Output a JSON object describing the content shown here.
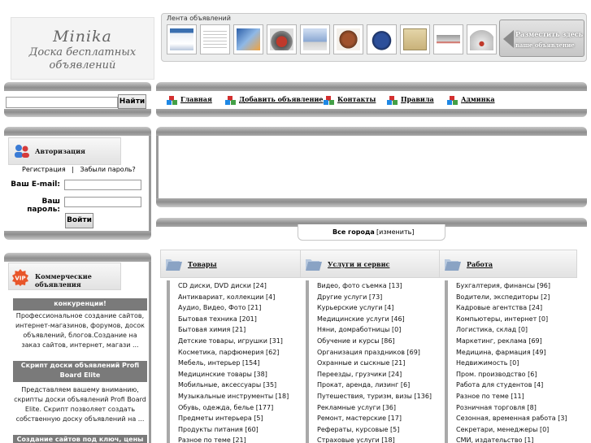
{
  "logo": {
    "line1": "Minika",
    "line2": "Доска бесплатных",
    "line3": "объявлений"
  },
  "ad_strip": {
    "title": "Лента объявлений",
    "place_ad_line1": "Разместить здесь",
    "place_ad_line2": "ваше объявление"
  },
  "search": {
    "value": "",
    "button_label": "Найти"
  },
  "nav": [
    {
      "label": "Главная"
    },
    {
      "label": "Добавить объявление"
    },
    {
      "label": "Контакты"
    },
    {
      "label": "Правила"
    },
    {
      "label": "Админка"
    }
  ],
  "auth": {
    "title": "Авторизация",
    "register_link": "Регистрация",
    "separator": "|",
    "forgot_link": "Забыли пароль?",
    "email_label": "Ваш E-mail:",
    "password_label": "Ваш пароль:",
    "login_button": "Войти"
  },
  "commercial": {
    "title": "Коммерческие объявления",
    "items": [
      {
        "heading": "конкуренции!",
        "text": "Профессиональное создание сайтов, интернет-магазинов, форумов, досок объявлений, блогов.Создание на заказ сайтов, интернет, магази ..."
      },
      {
        "heading": "Скрипт доски объявлений Profi Board Elite",
        "text": "Представляем вашему вниманию, скрипты доски объявлений Profi Board Elite. Скрипт позволяет создать собственную доску объявлений на ..."
      },
      {
        "heading": "Создание сайтов под ключ, цены вне",
        "text": ""
      }
    ]
  },
  "city": {
    "label": "Все города",
    "change_link": "[изменить]"
  },
  "categories": [
    {
      "title": "Товары",
      "items": [
        "CD диски, DVD диски [24]",
        "Антиквариат, коллекции [4]",
        "Аудио, Видео, Фото [21]",
        "Бытовая техника [201]",
        "Бытовая химия [21]",
        "Детские товары, игрушки [31]",
        "Косметика, парфюмерия [62]",
        "Мебель, интерьер [154]",
        "Медицинские товары [38]",
        "Мобильные, аксессуары [35]",
        "Музыкальные инструменты [18]",
        "Обувь, одежда, белье [177]",
        "Предметы интерьера [5]",
        "Продукты питания [60]",
        "Разное по теме [21]"
      ]
    },
    {
      "title": "Услуги и сервис",
      "items": [
        "Видео, фото съемка [13]",
        "Другие услуги [73]",
        "Курьерские услуги [4]",
        "Медицинские услуги [46]",
        "Няни, домработницы [0]",
        "Обучение и курсы [86]",
        "Организация праздников [69]",
        "Охранные и сыскные [21]",
        "Переезды, грузчики [24]",
        "Прокат, аренда, лизинг [6]",
        "Путешествия, туризм, визы [136]",
        "Рекламные услуги [36]",
        "Ремонт, мастерские [17]",
        "Рефераты, курсовые [5]",
        "Страховые услуги [18]"
      ]
    },
    {
      "title": "Работа",
      "items": [
        "Бухгалтерия, финансы [96]",
        "Водители, экспедиторы [2]",
        "Кадровые агентства [24]",
        "Компьютеры, интернет [0]",
        "Логистика, склад [0]",
        "Маркетинг, реклама [69]",
        "Медицина, фармация [49]",
        "Недвижимость [0]",
        "Пром. производство [6]",
        "Работа для студентов [4]",
        "Разное по теме [11]",
        "Розничная торговля [8]",
        "Сезонная, временная работа [3]",
        "Секретари, менеджеры [0]",
        "СМИ, издательство [1]"
      ]
    }
  ]
}
